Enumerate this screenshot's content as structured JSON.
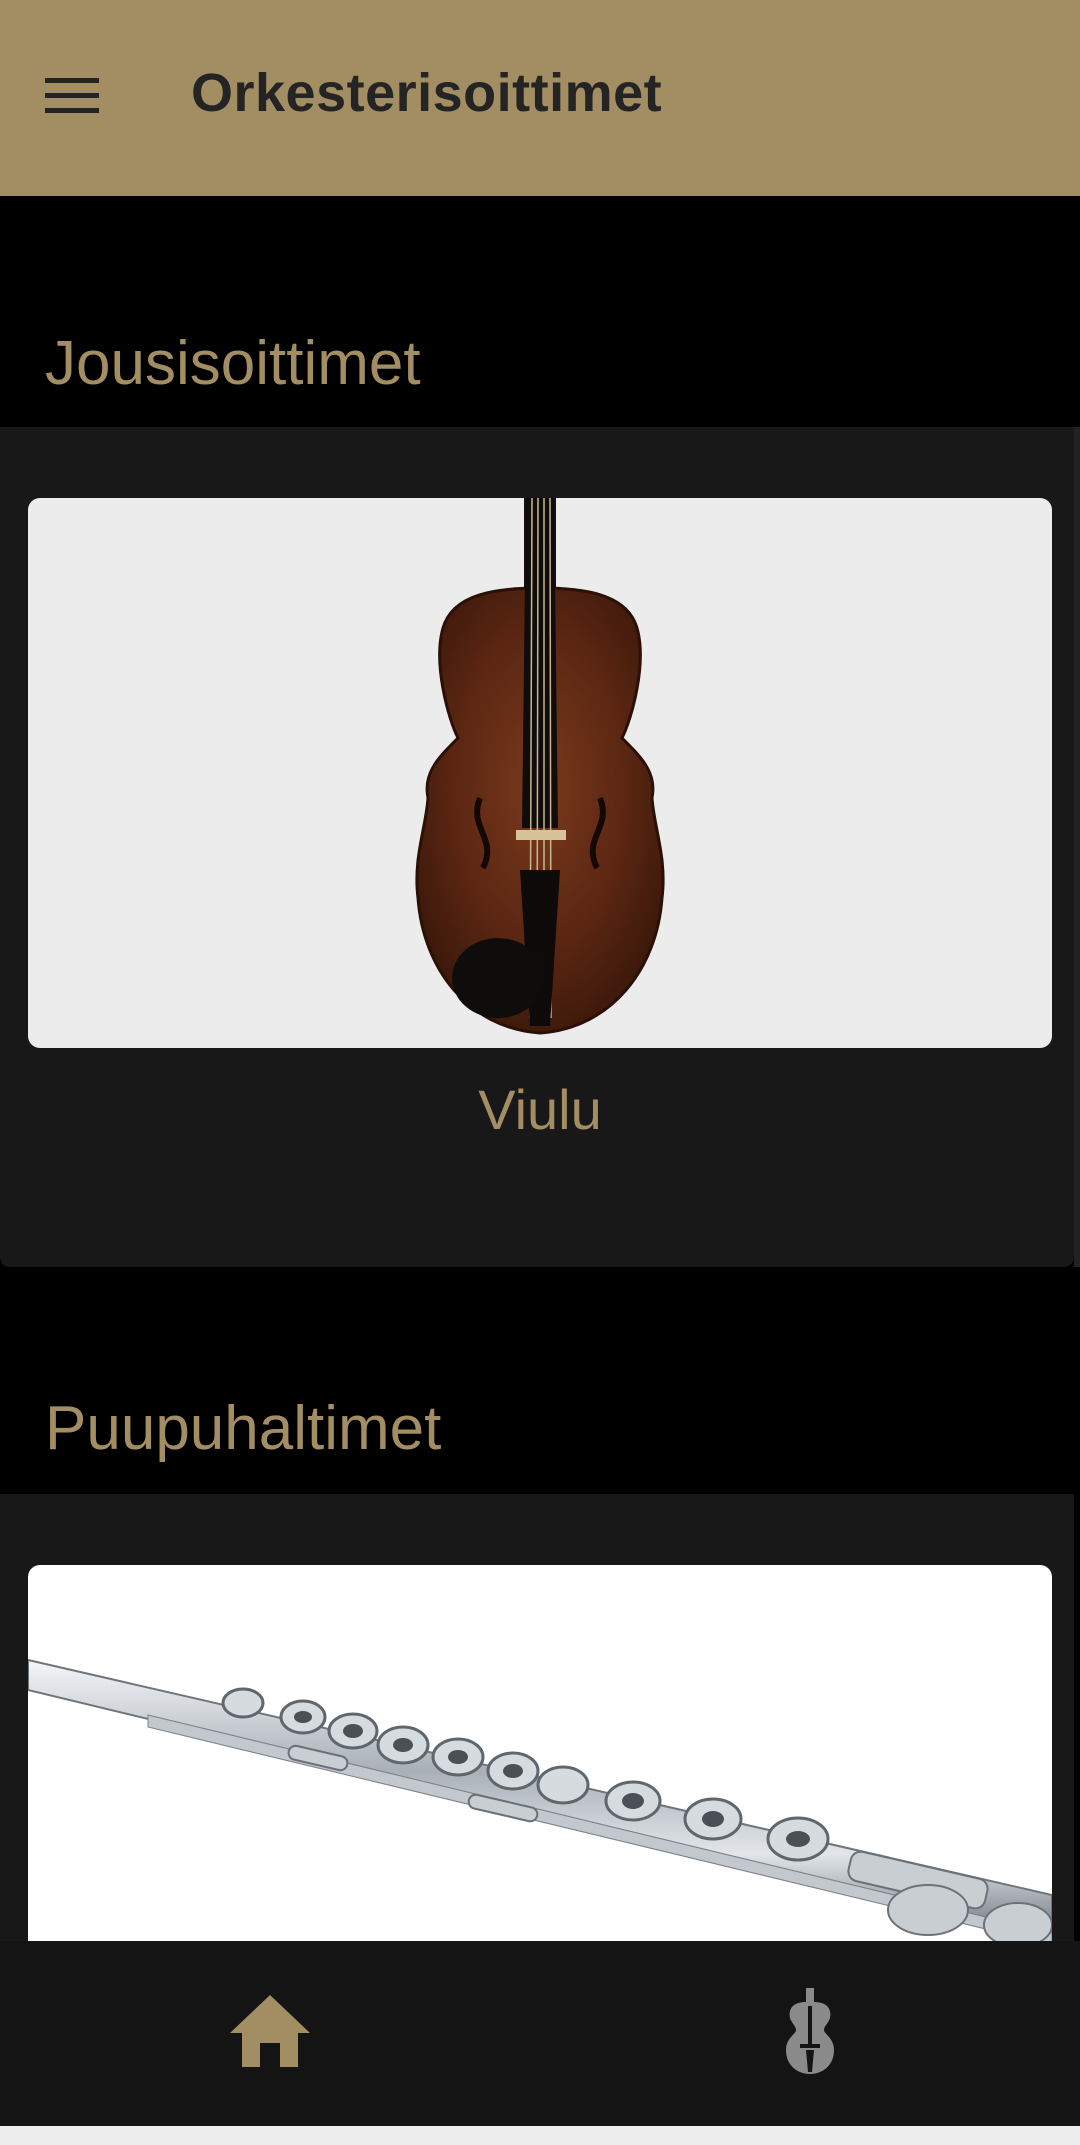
{
  "app_bar": {
    "title": "Orkesterisoittimet",
    "menu_icon": "menu-icon",
    "background": "#a38e63"
  },
  "sections": [
    {
      "title": "Jousisoittimet",
      "card": {
        "label": "Viulu",
        "image": "violin-image"
      }
    },
    {
      "title": "Puupuhaltimet",
      "card": {
        "label": "",
        "image": "flute-image"
      }
    }
  ],
  "bottom_nav": {
    "items": [
      {
        "icon": "home-icon",
        "color": "#a38e63"
      },
      {
        "icon": "violin-icon",
        "color": "#8a8a8a"
      }
    ]
  },
  "colors": {
    "accent": "#a38e63",
    "panel": "#181818",
    "background": "#000000"
  }
}
